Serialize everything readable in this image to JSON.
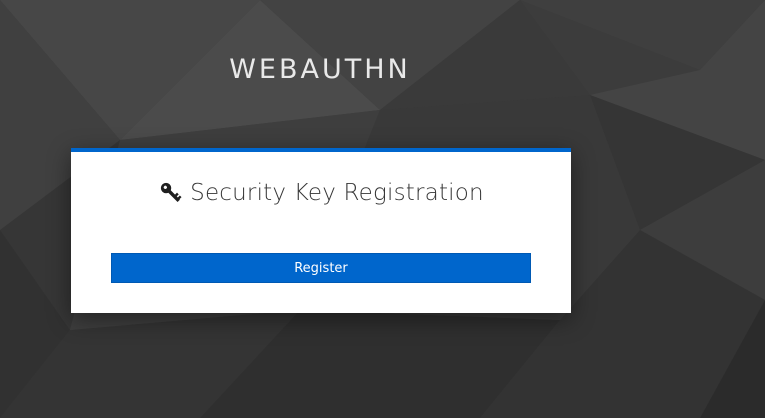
{
  "realm": {
    "title": "WEBAUTHN"
  },
  "card": {
    "icon": "key-icon",
    "title": "Security Key Registration",
    "register_label": "Register"
  },
  "colors": {
    "accent": "#0066cc",
    "background": "#3b3b3b",
    "card": "#ffffff"
  }
}
